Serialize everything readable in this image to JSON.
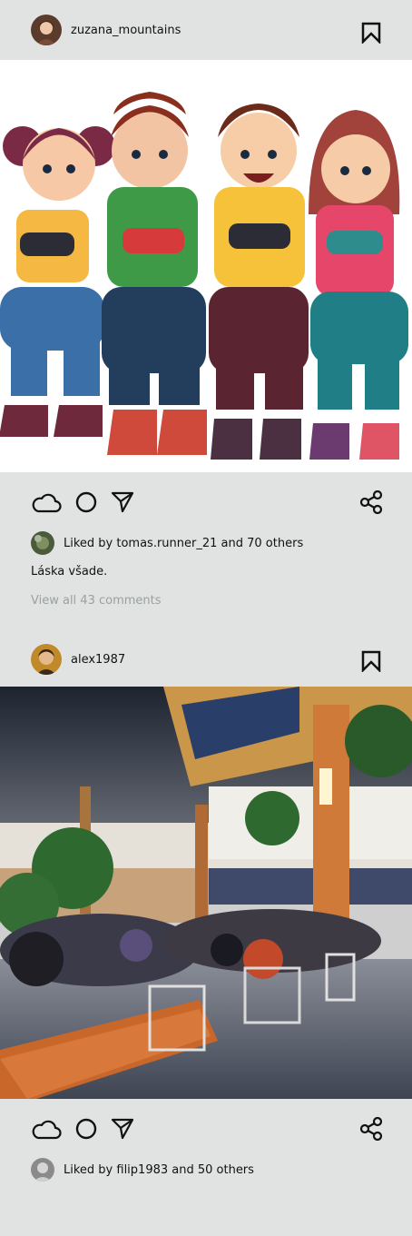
{
  "posts": [
    {
      "username": "zuzana_mountains",
      "avatar_icon": "user-avatar-woman",
      "image_alt": "Four cartoon kids holding game controllers",
      "likes_text": "Liked by tomas.runner_21 and 70 others",
      "caption": "Láska všade.",
      "comments_link": "View all 43 comments"
    },
    {
      "username": "alex1987",
      "avatar_icon": "user-avatar-man",
      "image_alt": "Busy indoor food court",
      "likes_text": "Liked by filip1983 and 50 others"
    }
  ],
  "icons": {
    "like": "cloud-icon",
    "comment": "circle-icon",
    "send": "send-icon",
    "share": "share-icon",
    "bookmark": "bookmark-icon"
  },
  "colors": {
    "background": "#e1e3e3",
    "muted_text": "#9aa0a0"
  }
}
